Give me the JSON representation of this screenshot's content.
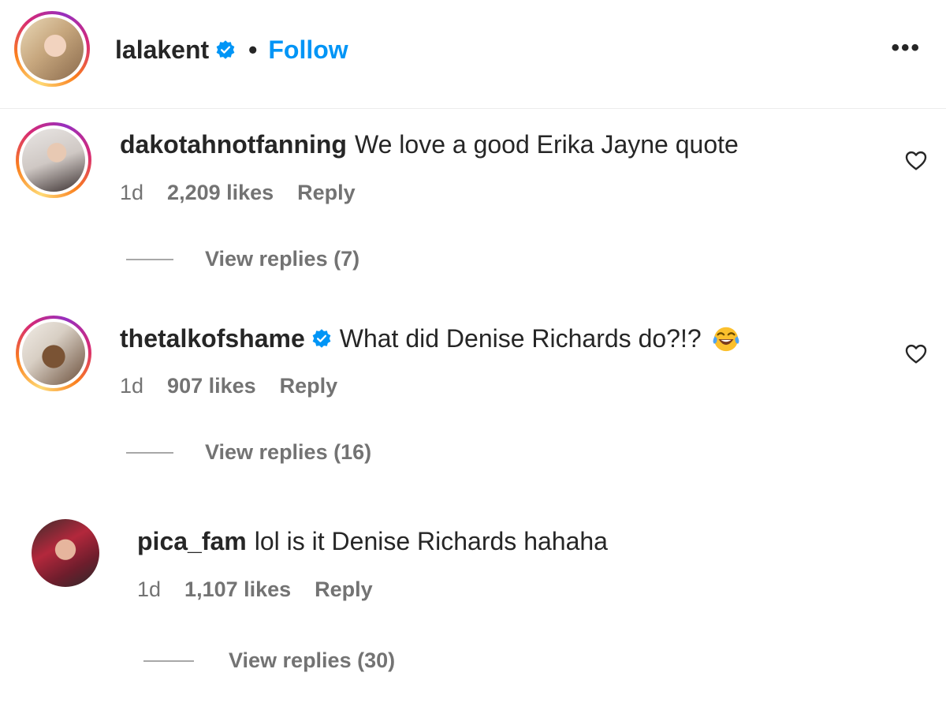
{
  "header": {
    "username": "lalakent",
    "separator": "•",
    "follow_label": "Follow",
    "more_label": "•••",
    "verified": true
  },
  "comments": [
    {
      "username": "dakotahnotfanning",
      "verified": false,
      "text": "We love a good Erika Jayne quote",
      "time": "1d",
      "likes": "2,209 likes",
      "reply_label": "Reply",
      "view_replies": "View replies (7)",
      "liked": false
    },
    {
      "username": "thetalkofshame",
      "verified": true,
      "text": "What did Denise Richards do?!?",
      "emoji": "face-with-tears-of-joy",
      "time": "1d",
      "likes": "907 likes",
      "reply_label": "Reply",
      "view_replies": "View replies (16)",
      "liked": false
    },
    {
      "username": "pica_fam",
      "verified": false,
      "text": "lol is it Denise Richards hahaha",
      "time": "1d",
      "likes": "1,107 likes",
      "reply_label": "Reply",
      "view_replies": "View replies (30)"
    }
  ],
  "colors": {
    "link": "#0095f6",
    "verified": "#0095f6",
    "meta": "#737373",
    "text": "#262626"
  }
}
